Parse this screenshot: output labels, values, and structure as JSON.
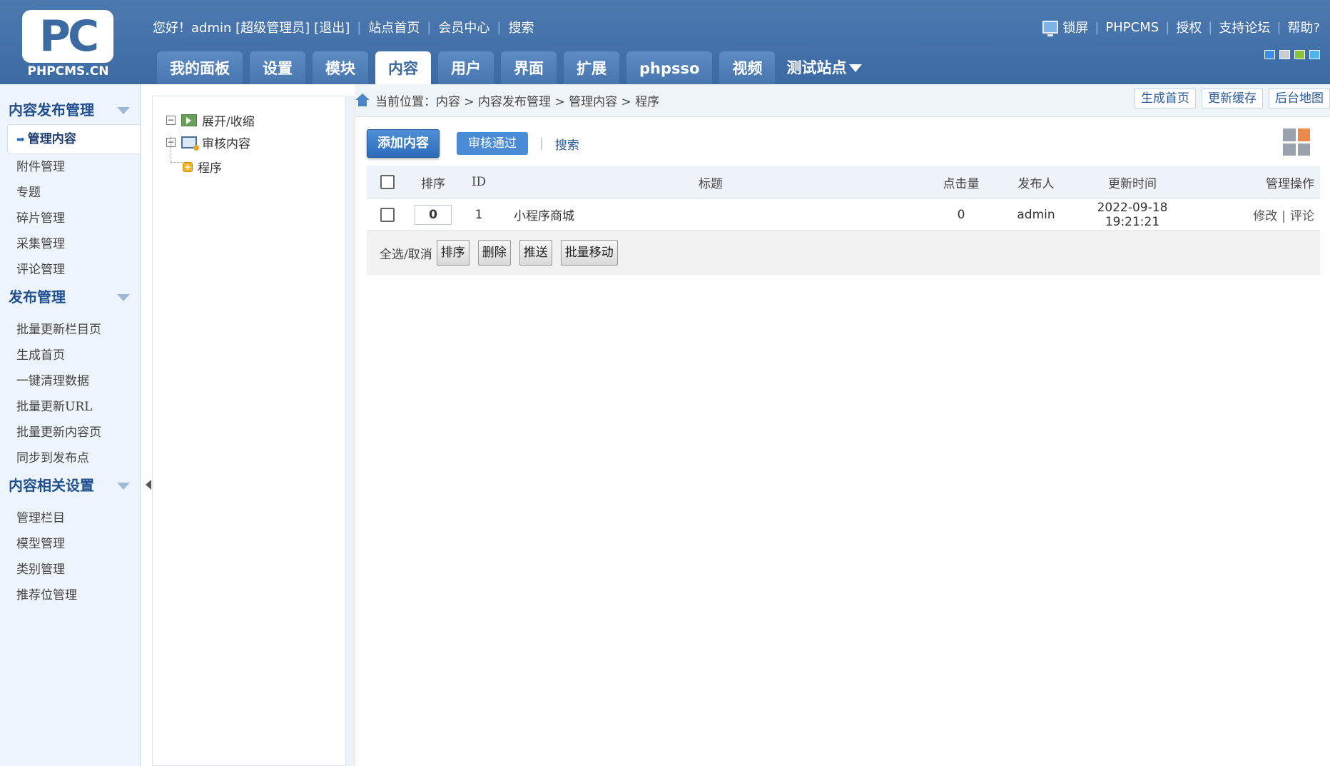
{
  "header": {
    "logo_mark": "PC",
    "logo_text": "PHPCMS.CN",
    "greeting": "您好！admin [超级管理员]",
    "logout": "[退出]",
    "links": [
      "站点首页",
      "会员中心",
      "搜索"
    ],
    "right_links": [
      "锁屏",
      "PHPCMS",
      "授权",
      "支持论坛",
      "帮助?"
    ],
    "skin_colors": [
      "#3a8ee6",
      "#c9ccd0",
      "#8ac43f",
      "#4fb3e8"
    ]
  },
  "nav": {
    "tabs": [
      "我的面板",
      "设置",
      "模块",
      "内容",
      "用户",
      "界面",
      "扩展",
      "phpsso",
      "视频"
    ],
    "active": "内容",
    "site": "测试站点"
  },
  "sidebar": {
    "groups": [
      {
        "title": "内容发布管理",
        "items": [
          "管理内容",
          "附件管理",
          "专题",
          "碎片管理",
          "采集管理",
          "评论管理"
        ]
      },
      {
        "title": "发布管理",
        "items": [
          "批量更新栏目页",
          "生成首页",
          "一键清理数据",
          "批量更新URL",
          "批量更新内容页",
          "同步到发布点"
        ]
      },
      {
        "title": "内容相关设置",
        "items": [
          "管理栏目",
          "模型管理",
          "类别管理",
          "推荐位管理"
        ]
      }
    ],
    "active_item": "管理内容"
  },
  "tree": {
    "toggle": "展开/收缩",
    "audit": "审核内容",
    "category": "程序"
  },
  "breadcrumb": {
    "label": "当前位置：内容 > 内容发布管理 > 管理内容 > 程序",
    "buttons": [
      "生成首页",
      "更新缓存",
      "后台地图"
    ]
  },
  "toolbar": {
    "add": "添加内容",
    "approved": "审核通过",
    "search": "搜索"
  },
  "table": {
    "headers": {
      "sort": "排序",
      "id": "ID",
      "title": "标题",
      "clicks": "点击量",
      "publisher": "发布人",
      "updated": "更新时间",
      "ops": "管理操作"
    },
    "rows": [
      {
        "sort": "0",
        "id": "1",
        "title": "小程序商城",
        "clicks": "0",
        "publisher": "admin",
        "updated": "2022-09-18 19:21:21",
        "edit": "修改",
        "comment": "评论"
      }
    ]
  },
  "footer": {
    "select_all": "全选/取消",
    "buttons": [
      "排序",
      "删除",
      "推送",
      "批量移动"
    ]
  },
  "colors": {
    "header_bg": "#3c6aa3",
    "accent": "#2d6bb9"
  }
}
